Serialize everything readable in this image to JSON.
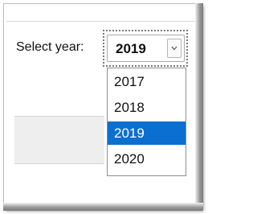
{
  "form": {
    "year_label": "Select year:",
    "year_select": {
      "selected_value": "2019",
      "button_icon": "chevron-down-icon",
      "expanded": true
    }
  },
  "dropdown": {
    "options": [
      {
        "label": "2017"
      },
      {
        "label": "2018"
      },
      {
        "label": "2019",
        "highlighted": true
      },
      {
        "label": "2020"
      }
    ]
  },
  "colors": {
    "highlight": "#0a6fd1",
    "highlight_text": "#ffffff",
    "band": "#eeeeee"
  }
}
